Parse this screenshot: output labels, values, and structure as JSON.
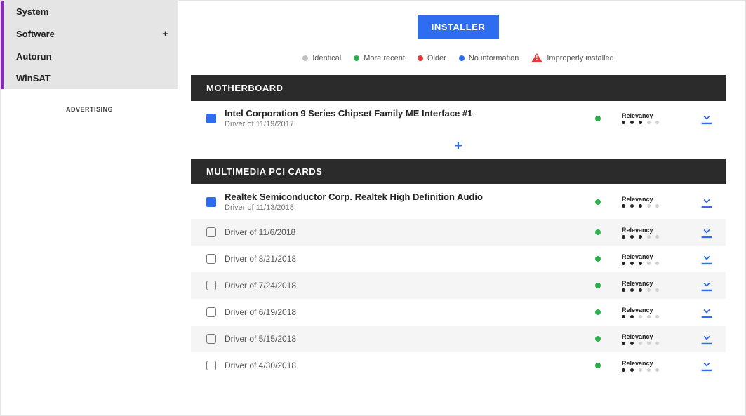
{
  "sidebar": {
    "items": [
      {
        "label": "System",
        "has_plus": false
      },
      {
        "label": "Software",
        "has_plus": true
      },
      {
        "label": "Autorun",
        "has_plus": false
      },
      {
        "label": "WinSAT",
        "has_plus": false
      }
    ],
    "advertising": "ADVERTISING"
  },
  "installer_button": "INSTALLER",
  "legend": {
    "identical": "Identical",
    "recent": "More recent",
    "older": "Older",
    "noinfo": "No information",
    "improper": "Improperly installed"
  },
  "sections": [
    {
      "title": "MOTHERBOARD",
      "rows": [
        {
          "name": "Intel Corporation 9 Series Chipset Family ME Interface #1",
          "subtitle": "Driver of 11/19/2017",
          "box_filled": true,
          "status": "green",
          "relevancy": 3,
          "relevancy_label": "Relevancy"
        }
      ],
      "expand": true
    },
    {
      "title": "MULTIMEDIA PCI CARDS",
      "rows": [
        {
          "name": "Realtek Semiconductor Corp. Realtek High Definition Audio",
          "subtitle": "Driver of 11/13/2018",
          "box_filled": true,
          "status": "green",
          "relevancy": 3,
          "relevancy_label": "Relevancy"
        },
        {
          "label": "Driver of 11/6/2018",
          "checkbox": true,
          "status": "green",
          "relevancy": 3,
          "relevancy_label": "Relevancy"
        },
        {
          "label": "Driver of 8/21/2018",
          "checkbox": true,
          "status": "green",
          "relevancy": 3,
          "relevancy_label": "Relevancy"
        },
        {
          "label": "Driver of 7/24/2018",
          "checkbox": true,
          "status": "green",
          "relevancy": 3,
          "relevancy_label": "Relevancy"
        },
        {
          "label": "Driver of 6/19/2018",
          "checkbox": true,
          "status": "green",
          "relevancy": 2,
          "relevancy_label": "Relevancy"
        },
        {
          "label": "Driver of 5/15/2018",
          "checkbox": true,
          "status": "green",
          "relevancy": 2,
          "relevancy_label": "Relevancy"
        },
        {
          "label": "Driver of 4/30/2018",
          "checkbox": true,
          "status": "green",
          "relevancy": 2,
          "relevancy_label": "Relevancy"
        }
      ],
      "expand": false
    }
  ]
}
